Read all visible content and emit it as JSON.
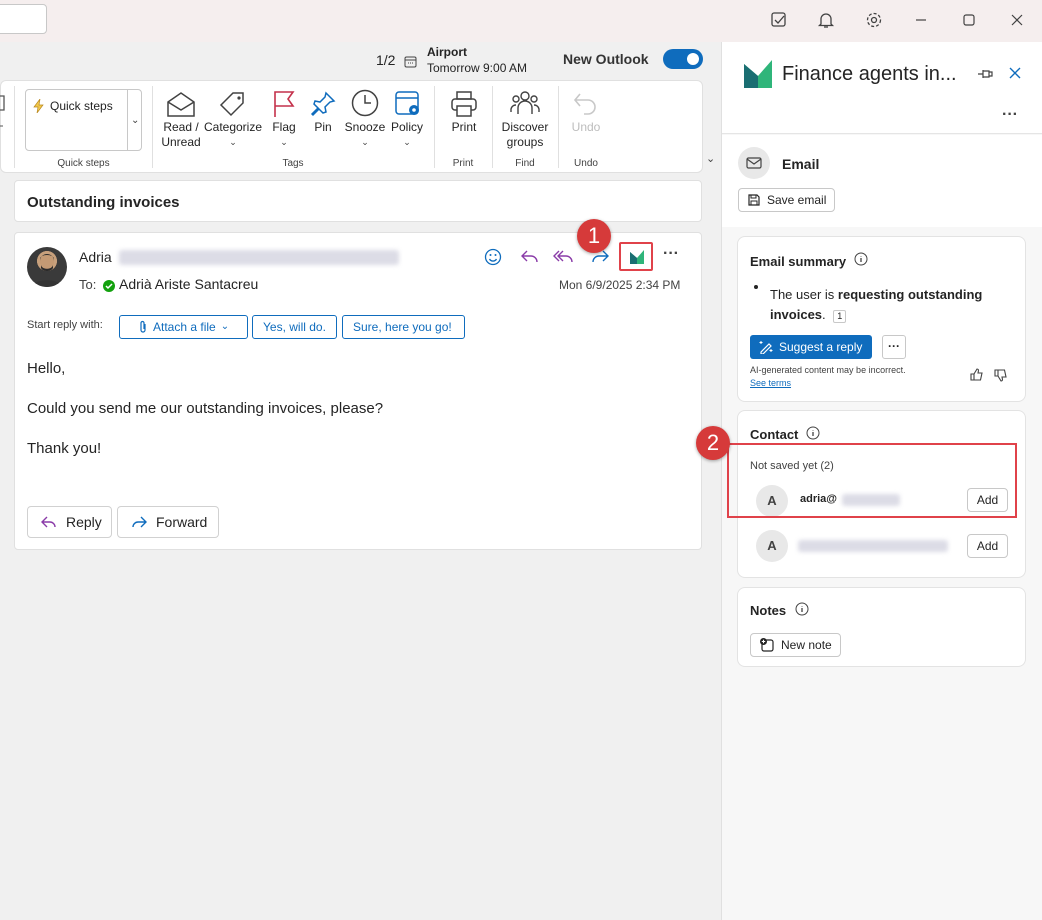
{
  "titlebar": {
    "icons": [
      "todo-icon",
      "bell-icon",
      "gear-icon",
      "minimize-icon",
      "maximize-icon",
      "close-icon"
    ]
  },
  "notification": {
    "count": "1/2",
    "title": "Airport",
    "time": "Tomorrow 9:00 AM"
  },
  "new_outlook": {
    "label": "New Outlook",
    "on": true
  },
  "ribbon": {
    "quick_steps": {
      "label": "Quick steps",
      "group": "Quick steps"
    },
    "tags": {
      "group": "Tags",
      "read_unread": [
        "Read /",
        "Unread"
      ],
      "categorize": "Categorize",
      "flag": "Flag",
      "pin": "Pin",
      "snooze": "Snooze",
      "policy": "Policy"
    },
    "print": {
      "label": "Print",
      "group": "Print"
    },
    "find": {
      "label": [
        "Discover",
        "groups"
      ],
      "group": "Find"
    },
    "undo": {
      "label": "Undo",
      "group": "Undo"
    }
  },
  "message": {
    "subject": "Outstanding invoices",
    "sender_first": "Adria",
    "to_label": "To:",
    "recipient": "Adrià Ariste Santacreu",
    "date": "Mon 6/9/2025 2:34 PM",
    "start_reply_label": "Start reply with:",
    "quick_replies": [
      "Attach a file",
      "Yes, will do.",
      "Sure, here you go!"
    ],
    "body": [
      "Hello,",
      "Could you send me our outstanding invoices, please?",
      "Thank you!"
    ],
    "reply_label": "Reply",
    "forward_label": "Forward"
  },
  "pane": {
    "title": "Finance agents in...",
    "email_label": "Email",
    "save_email_label": "Save email",
    "summary": {
      "title": "Email summary",
      "text_plain": "The user is ",
      "text_bold_1": "requesting outstanding",
      "text_bold_2": "invoices",
      "text_end": ".",
      "ref": "1",
      "suggest_label": "Suggest a reply",
      "more_label": "···",
      "disclaimer": "AI-generated content may be incorrect.",
      "terms": "See terms"
    },
    "contact": {
      "title": "Contact",
      "not_saved": "Not saved yet (2)",
      "items": [
        {
          "initial": "A",
          "email_prefix": "adria@",
          "add": "Add"
        },
        {
          "initial": "A",
          "email_prefix": "",
          "add": "Add"
        }
      ]
    },
    "notes": {
      "title": "Notes",
      "new_note": "New note"
    }
  },
  "callouts": [
    "1",
    "2"
  ],
  "colors": {
    "accent": "#0f6cbd",
    "callout": "#d63a3a",
    "flag": "#c4314b"
  }
}
